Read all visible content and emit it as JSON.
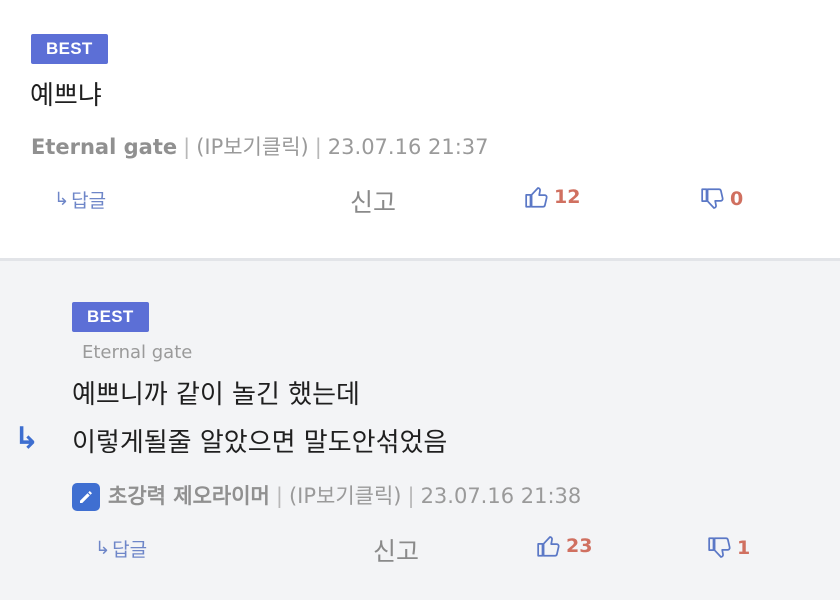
{
  "comments": [
    {
      "badge": "BEST",
      "text_lines": [
        "예쁘냐"
      ],
      "author": "Eternal gate",
      "ip_label": "(IP보기클릭)",
      "timestamp": "23.07.16 21:37",
      "reply_label": "답글",
      "report_label": "신고",
      "likes": "12",
      "dislikes": "0"
    },
    {
      "badge": "BEST",
      "parent_author": "Eternal gate",
      "text_lines": [
        "예쁘니까 같이 놀긴 했는데",
        "이렇게될줄 알았으면 말도안섞었음"
      ],
      "author": "초강력 제오라이머",
      "ip_label": "(IP보기클릭)",
      "timestamp": "23.07.16 21:38",
      "reply_label": "답글",
      "report_label": "신고",
      "likes": "23",
      "dislikes": "1"
    }
  ],
  "icons": {
    "reply": "reply-arrow-icon",
    "like": "thumbs-up-icon",
    "dislike": "thumbs-down-icon",
    "edit": "pencil-icon",
    "nested_reply": "curved-arrow-icon"
  },
  "colors": {
    "badge": "#5c6fd6",
    "reply_link": "#6e86c8",
    "vote_count": "#d07060",
    "edit_icon_bg": "#3f6fd1"
  }
}
